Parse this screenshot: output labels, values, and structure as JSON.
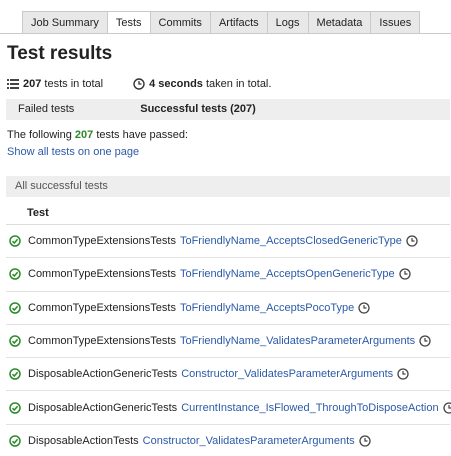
{
  "tabs": [
    "Job Summary",
    "Tests",
    "Commits",
    "Artifacts",
    "Logs",
    "Metadata",
    "Issues"
  ],
  "active_tab": "Tests",
  "title": "Test results",
  "summary": {
    "total_count": "207",
    "total_text": "tests in total",
    "duration": "4 seconds",
    "duration_text": "taken in total."
  },
  "subtabs": {
    "failed": "Failed tests",
    "successful": "Successful tests (207)"
  },
  "passed": {
    "prefix": "The following",
    "count": "207",
    "suffix": "tests have passed:"
  },
  "show_all": "Show all tests on one page",
  "group_header": "All successful tests",
  "column_header": "Test",
  "tests": [
    {
      "cls": "CommonTypeExtensionsTests",
      "name": "ToFriendlyName_AcceptsClosedGenericType"
    },
    {
      "cls": "CommonTypeExtensionsTests",
      "name": "ToFriendlyName_AcceptsOpenGenericType"
    },
    {
      "cls": "CommonTypeExtensionsTests",
      "name": "ToFriendlyName_AcceptsPocoType"
    },
    {
      "cls": "CommonTypeExtensionsTests",
      "name": "ToFriendlyName_ValidatesParameterArguments"
    },
    {
      "cls": "DisposableActionGenericTests",
      "name": "Constructor_ValidatesParameterArguments"
    },
    {
      "cls": "DisposableActionGenericTests",
      "name": "CurrentInstance_IsFlowed_ThroughToDisposeAction"
    },
    {
      "cls": "DisposableActionTests",
      "name": "Constructor_ValidatesParameterArguments"
    }
  ],
  "colors": {
    "link": "#2b5aa8",
    "success": "#2a8a2a",
    "tab_bg": "#e8e8e8",
    "band_bg": "#eeeeee"
  },
  "icons": {
    "list": "list-icon",
    "clock": "clock-icon",
    "success": "check-circle-icon"
  }
}
